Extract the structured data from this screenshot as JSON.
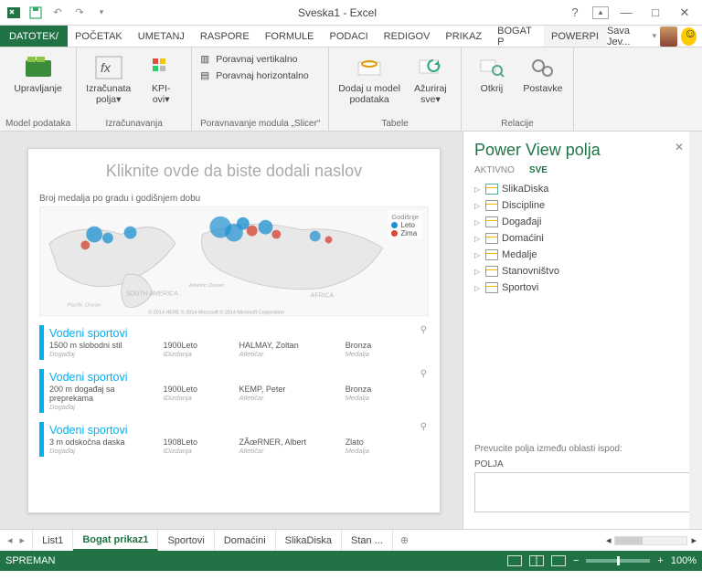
{
  "app_title": "Sveska1 - Excel",
  "qat": {
    "excel": "xl",
    "save": "save",
    "undo": "undo",
    "redo": "redo"
  },
  "tabs": {
    "file": "DATOTEK/",
    "items": [
      "POČETAK",
      "UMETANJ",
      "RASPORE",
      "FORMULE",
      "PODACI",
      "REDIGOV",
      "PRIKAZ",
      "BOGAT P",
      "POWERPI"
    ],
    "active_index": 8
  },
  "user": {
    "name": "Sava Jev..."
  },
  "ribbon": {
    "g1": {
      "label": "Model podataka",
      "btn": "Upravljanje"
    },
    "g2": {
      "label": "Izračunavanja",
      "b1": "Izračunata\npolja▾",
      "b2": "KPI-\novi▾"
    },
    "g3": {
      "label": "Poravnavanje modula „Slicer“",
      "r1": "Poravnaj vertikalno",
      "r2": "Poravnaj horizontalno"
    },
    "g4": {
      "label": "Tabele",
      "b1": "Dodaj u model\npodataka",
      "b2": "Ažuriraj\nsve▾"
    },
    "g5": {
      "label": "Relacije",
      "b1": "Otkrij",
      "b2": "Postavke"
    }
  },
  "powerview": {
    "title_placeholder": "Kliknite ovde da biste dodali naslov",
    "map_caption": "Broj medalja po gradu i godišnjem dobu",
    "legend_title": "Godišnje",
    "legend": [
      {
        "color": "#1e90d2",
        "label": "Leto"
      },
      {
        "color": "#d24a3a",
        "label": "Zima"
      }
    ],
    "map_credit": "© 2014 HERE © 2014 Microsoft © 2014 Microsoft Corporation",
    "cards": [
      {
        "title": "Vodeni sportovi",
        "c1": "1500 m slobodni stil",
        "k1": "Događaj",
        "c2": "1900Leto",
        "k2": "IDizdanja",
        "c3": "HALMAY, Zoltan",
        "k3": "Atletičar",
        "c4": "Bronza",
        "k4": "Medalja"
      },
      {
        "title": "Vodeni sportovi",
        "c1": "200 m događaj sa preprekama",
        "k1": "Događaj",
        "c2": "1900Leto",
        "k2": "IDizdanja",
        "c3": "KEMP, Peter",
        "k3": "Atletičar",
        "c4": "Bronza",
        "k4": "Medalja"
      },
      {
        "title": "Vodeni sportovi",
        "c1": "3 m odskočna daska",
        "k1": "Događaj",
        "c2": "1908Leto",
        "k2": "IDizdanja",
        "c3": "ZÃœRNER, Albert",
        "k3": "Atletičar",
        "c4": "Zlato",
        "k4": "Medalja"
      }
    ]
  },
  "pane": {
    "title": "Power View polja",
    "tabs": [
      "AKTIVNO",
      "SVE"
    ],
    "active_tab": 1,
    "fields": [
      "SlikaDiska",
      "Discipline",
      "Događaji",
      "Domaćini",
      "Medalje",
      "Stanovništvo",
      "Sportovi"
    ],
    "drop_hint": "Prevucite polja između oblasti ispod:",
    "drop_label": "POLJA"
  },
  "sheets": {
    "items": [
      "List1",
      "Bogat prikaz1",
      "Sportovi",
      "Domaćini",
      "SlikaDiska",
      "Stan  ..."
    ],
    "active_index": 1
  },
  "status": {
    "left": "SPREMAN",
    "zoom": "100%"
  }
}
